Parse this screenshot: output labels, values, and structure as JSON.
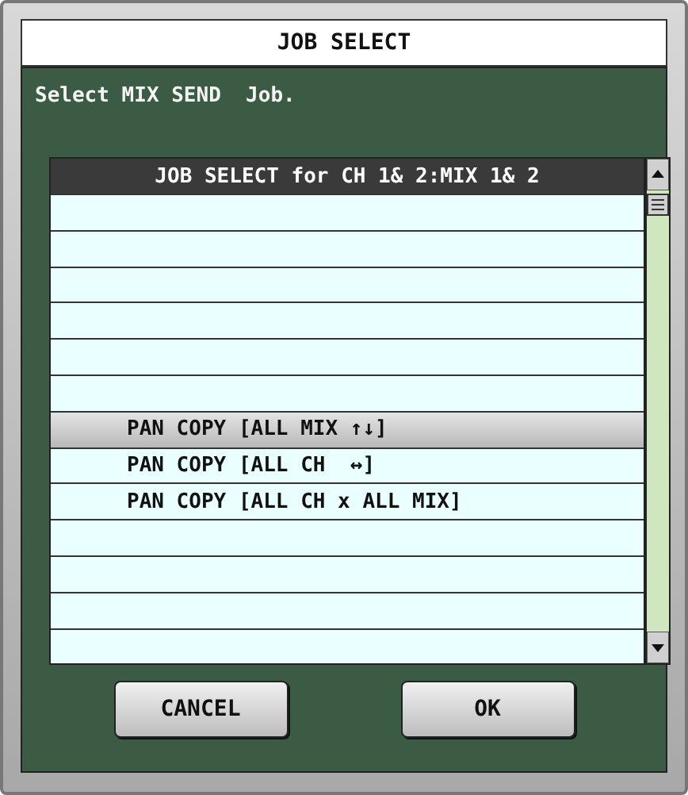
{
  "window": {
    "title": "JOB SELECT"
  },
  "instruction": "Select MIX SEND  Job.",
  "list": {
    "header": "JOB SELECT for CH 1& 2:MIX 1& 2",
    "items": [
      {
        "label": "PAN COPY [ALL MIX ↑↓]",
        "selected": true
      },
      {
        "label": "PAN COPY [ALL CH  ↔]",
        "selected": false
      },
      {
        "label": "PAN COPY [ALL CH x ALL MIX]",
        "selected": false
      }
    ]
  },
  "buttons": [
    {
      "label": "CANCEL"
    },
    {
      "label": "OK"
    }
  ]
}
